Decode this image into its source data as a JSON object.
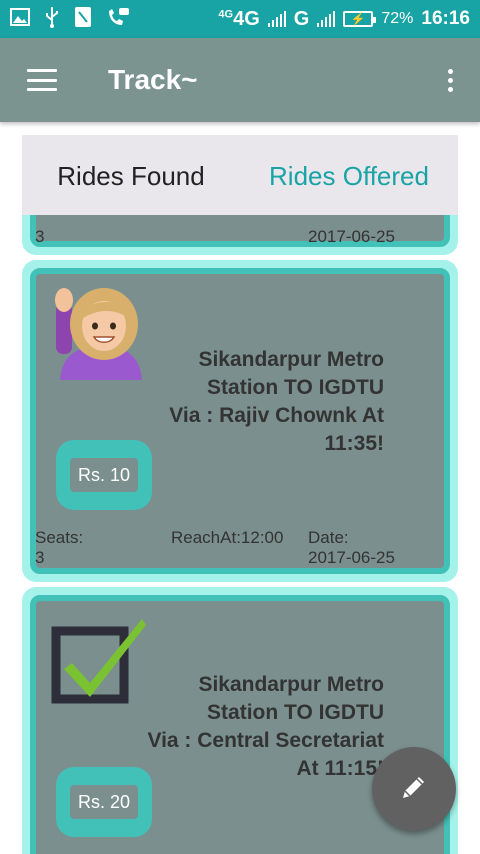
{
  "status_bar": {
    "network_badge": "4G",
    "network_label": "4G",
    "network_label_2": "G",
    "battery_percent": "72%",
    "time": "16:16"
  },
  "toolbar": {
    "title": "Track~",
    "menu_icon": "menu-icon",
    "overflow_icon": "more-vert-icon"
  },
  "tabs": {
    "found": "Rides Found",
    "offered": "Rides Offered"
  },
  "rides": [
    {
      "seats_value": "3",
      "date_value": "2017-06-25"
    },
    {
      "avatar_icon": "woman-raising-hand-icon",
      "route_line1": "Sikandarpur Metro",
      "route_line2": "Station TO IGDTU",
      "route_line3": "Via : Rajiv Chownk At",
      "route_line4": "11:35!",
      "price": "Rs. 10",
      "seats_label": "Seats:",
      "seats_value": "3",
      "reach": "ReachAt:12:00",
      "date_label": "Date:",
      "date_value": "2017-06-25"
    },
    {
      "avatar_icon": "check-box-icon",
      "route_line1": "Sikandarpur Metro",
      "route_line2": "Station TO IGDTU",
      "route_line3": "Via : Central Secretariat",
      "route_line4": "At 11:15!",
      "price": "Rs. 20"
    }
  ],
  "fab": {
    "icon": "pencil-icon"
  }
}
